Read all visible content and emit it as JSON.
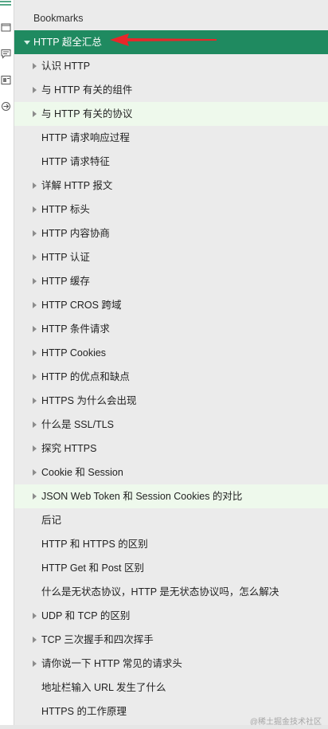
{
  "colors": {
    "selected_bg": "#1f8a60",
    "highlight_bg": "#eef9ec",
    "panel_bg": "#ebebeb",
    "arrow": "#e8272a"
  },
  "rail": {
    "icons": [
      "bookmark-list-icon",
      "page-icon",
      "comment-icon",
      "attachment-icon",
      "layers-icon"
    ]
  },
  "header": {
    "title": "Bookmarks"
  },
  "tree": [
    {
      "label": "HTTP 超全汇总",
      "level": 0,
      "expander": "expanded",
      "state": "selected"
    },
    {
      "label": "认识 HTTP",
      "level": 1,
      "expander": "collapsed",
      "state": "normal"
    },
    {
      "label": "与 HTTP 有关的组件",
      "level": 1,
      "expander": "collapsed",
      "state": "normal"
    },
    {
      "label": "与 HTTP 有关的协议",
      "level": 1,
      "expander": "collapsed",
      "state": "highlight"
    },
    {
      "label": "HTTP 请求响应过程",
      "level": 1,
      "expander": "none",
      "state": "normal"
    },
    {
      "label": "HTTP 请求特征",
      "level": 1,
      "expander": "none",
      "state": "normal"
    },
    {
      "label": "详解 HTTP 报文",
      "level": 1,
      "expander": "collapsed",
      "state": "normal"
    },
    {
      "label": "HTTP 标头",
      "level": 1,
      "expander": "collapsed",
      "state": "normal"
    },
    {
      "label": "HTTP 内容协商",
      "level": 1,
      "expander": "collapsed",
      "state": "normal"
    },
    {
      "label": "HTTP 认证",
      "level": 1,
      "expander": "collapsed",
      "state": "normal"
    },
    {
      "label": "HTTP 缓存",
      "level": 1,
      "expander": "collapsed",
      "state": "normal"
    },
    {
      "label": "HTTP CROS 跨域",
      "level": 1,
      "expander": "collapsed",
      "state": "normal"
    },
    {
      "label": "HTTP 条件请求",
      "level": 1,
      "expander": "collapsed",
      "state": "normal"
    },
    {
      "label": "HTTP Cookies",
      "level": 1,
      "expander": "collapsed",
      "state": "normal"
    },
    {
      "label": "HTTP 的优点和缺点",
      "level": 1,
      "expander": "collapsed",
      "state": "normal"
    },
    {
      "label": "HTTPS 为什么会出现",
      "level": 1,
      "expander": "collapsed",
      "state": "normal"
    },
    {
      "label": "什么是 SSL/TLS",
      "level": 1,
      "expander": "collapsed",
      "state": "normal"
    },
    {
      "label": "探究 HTTPS",
      "level": 1,
      "expander": "collapsed",
      "state": "normal"
    },
    {
      "label": "Cookie 和 Session",
      "level": 1,
      "expander": "collapsed",
      "state": "normal"
    },
    {
      "label": "JSON Web Token 和 Session Cookies 的对比",
      "level": 1,
      "expander": "collapsed",
      "state": "highlight"
    },
    {
      "label": "后记",
      "level": 1,
      "expander": "none",
      "state": "normal"
    },
    {
      "label": "HTTP 和 HTTPS 的区别",
      "level": 1,
      "expander": "none",
      "state": "normal"
    },
    {
      "label": "HTTP Get 和 Post 区别",
      "level": 1,
      "expander": "none",
      "state": "normal"
    },
    {
      "label": "什么是无状态协议，HTTP 是无状态协议吗，怎么解决",
      "level": 1,
      "expander": "none",
      "state": "normal"
    },
    {
      "label": "UDP 和 TCP 的区别",
      "level": 1,
      "expander": "collapsed",
      "state": "normal"
    },
    {
      "label": "TCP 三次握手和四次挥手",
      "level": 1,
      "expander": "collapsed",
      "state": "normal"
    },
    {
      "label": "请你说一下 HTTP 常见的请求头",
      "level": 1,
      "expander": "collapsed",
      "state": "normal"
    },
    {
      "label": "地址栏输入 URL 发生了什么",
      "level": 1,
      "expander": "none",
      "state": "normal"
    },
    {
      "label": "HTTPS 的工作原理",
      "level": 1,
      "expander": "none",
      "state": "normal"
    }
  ],
  "watermark": "@稀土掘金技术社区"
}
